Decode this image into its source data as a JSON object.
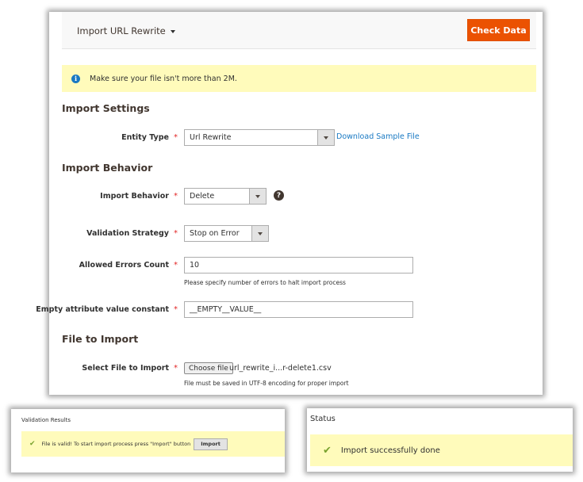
{
  "main": {
    "title": "Import URL Rewrite",
    "check_button": "Check Data",
    "notice": "Make sure your file isn't more than 2M.",
    "sections": {
      "import_settings": "Import Settings",
      "import_behavior": "Import Behavior",
      "file_to_import": "File to Import"
    },
    "fields": {
      "entity_type": {
        "label": "Entity Type",
        "value": "Url Rewrite",
        "link": "Download Sample File"
      },
      "import_behavior": {
        "label": "Import Behavior",
        "value": "Delete"
      },
      "validation_strategy": {
        "label": "Validation Strategy",
        "value": "Stop on Error"
      },
      "allowed_errors": {
        "label": "Allowed Errors Count",
        "value": "10",
        "note": "Please specify number of errors to halt import process"
      },
      "empty_attr": {
        "label": "Empty attribute value constant",
        "value": "__EMPTY__VALUE__"
      },
      "select_file": {
        "label": "Select File to Import",
        "button": "Choose file",
        "file_name": "url_rewrite_i...r-delete1.csv",
        "note": "File must be saved in UTF-8 encoding for proper import"
      }
    },
    "required_mark": "*"
  },
  "validation": {
    "title": "Validation Results",
    "message": "File is valid! To start import process press \"Import\" button",
    "import_button": "Import"
  },
  "status": {
    "title": "Status",
    "message": "Import successfully done"
  },
  "icons": {
    "info": "i",
    "help": "?",
    "check": "✔"
  }
}
